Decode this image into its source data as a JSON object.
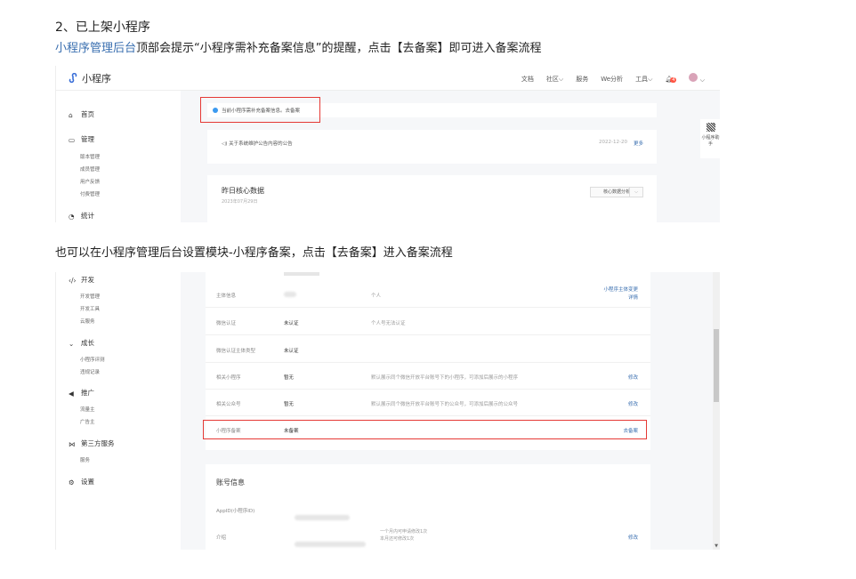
{
  "doc": {
    "heading": "2、已上架小程序",
    "line1_link": "小程序管理后台",
    "line1_rest": "顶部会提示“小程序需补充备案信息”的提醒，点击【去备案】即可进入备案流程",
    "line2": "也可以在小程序管理后台设置模块-小程序备案，点击【去备案】进入备案流程"
  },
  "shot1": {
    "brand": "小程序",
    "nav": [
      "文档",
      "社区",
      "服务",
      "We分析",
      "工具"
    ],
    "notify_count": "4",
    "sidebar": {
      "home": "首页",
      "manage": "管理",
      "manage_items": [
        "版本管理",
        "成员管理",
        "用户反馈",
        "付费管理"
      ],
      "stats": "统计"
    },
    "notice": "当前小程序需补充备案信息。去备案",
    "announcement": {
      "text": "关于系统维护公告内容的公告",
      "date": "2022-12-20",
      "more": "更多"
    },
    "core": {
      "title": "昨日核心数据",
      "date": "2023年07月29日",
      "button": "核心数据分析"
    },
    "helper": "小程序助手"
  },
  "shot2": {
    "sidebar": {
      "dev": "开发",
      "dev_items": [
        "开发管理",
        "开发工具",
        "云服务"
      ],
      "grow": "成长",
      "grow_items": [
        "小程序评测",
        "违规记录"
      ],
      "promo": "推广",
      "promo_items": [
        "流量主",
        "广告主"
      ],
      "third": "第三方服务",
      "third_items": [
        "服务"
      ],
      "settings": "设置"
    },
    "rows": [
      {
        "label": "主体信息",
        "value": "",
        "extra": "个人",
        "action": "小程序主体变更\n详情"
      },
      {
        "label": "微信认证",
        "value": "未认证",
        "extra": "个人号无法认证",
        "action": ""
      },
      {
        "label": "微信认证主体类型",
        "value": "未认证",
        "extra": "",
        "action": ""
      },
      {
        "label": "相关小程序",
        "value": "暂无",
        "extra": "默认展示同个微信开放平台账号下的小程序，可添加后展示的小程序",
        "action": "修改"
      },
      {
        "label": "相关公众号",
        "value": "暂无",
        "extra": "默认展示同个微信开放平台账号下的公众号，可添加后展示的公众号",
        "action": "修改"
      },
      {
        "label": "小程序备案",
        "value": "未备案",
        "extra": "",
        "action": "去备案"
      }
    ],
    "account": {
      "title": "账号信息",
      "appid_label": "AppID(小程序ID)",
      "intro_label": "介绍",
      "intro_note": "一个月内可申请修改1次\n本月还可修改1次",
      "intro_action": "修改"
    }
  }
}
